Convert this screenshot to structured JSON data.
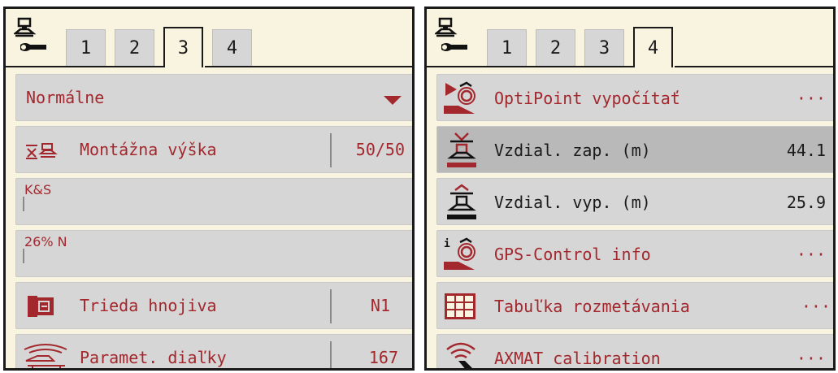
{
  "left_panel": {
    "tabs": [
      "1",
      "2",
      "3",
      "4"
    ],
    "active_tab": "3",
    "dropdown": {
      "value": "Normálne"
    },
    "rows": [
      {
        "label": "Montážna výška",
        "value": "50/50",
        "icon": "mounting-height-icon"
      },
      {
        "label": "K&S"
      },
      {
        "label": "26% N"
      },
      {
        "label": "Trieda hnojiva",
        "value": "N1",
        "icon": "fertilizer-class-icon"
      },
      {
        "label": "Paramet. diaľky",
        "value": "167",
        "icon": "remote-param-icon"
      }
    ]
  },
  "right_panel": {
    "tabs": [
      "1",
      "2",
      "3",
      "4"
    ],
    "active_tab": "4",
    "rows": [
      {
        "label": "OptiPoint vypočítať",
        "value": "···",
        "icon": "optipoint-icon"
      },
      {
        "label": "Vzdial. zap. (m)",
        "value": "44.1",
        "icon": "distance-on-icon"
      },
      {
        "label": "Vzdial. vyp. (m)",
        "value": "25.9",
        "icon": "distance-off-icon"
      },
      {
        "label": "GPS-Control info",
        "value": "···",
        "icon": "gps-info-icon"
      },
      {
        "label": "Tabuľka rozmetávania",
        "value": "···",
        "icon": "spread-table-icon"
      },
      {
        "label": "AXMAT calibration",
        "value": "···",
        "icon": "axmat-calibration-icon"
      }
    ]
  },
  "colors": {
    "panel_bg": "#f8f4e0",
    "row_bg": "#d6d6d6",
    "row_selected_bg": "#b9b9b9",
    "accent_text": "#a3282d"
  }
}
